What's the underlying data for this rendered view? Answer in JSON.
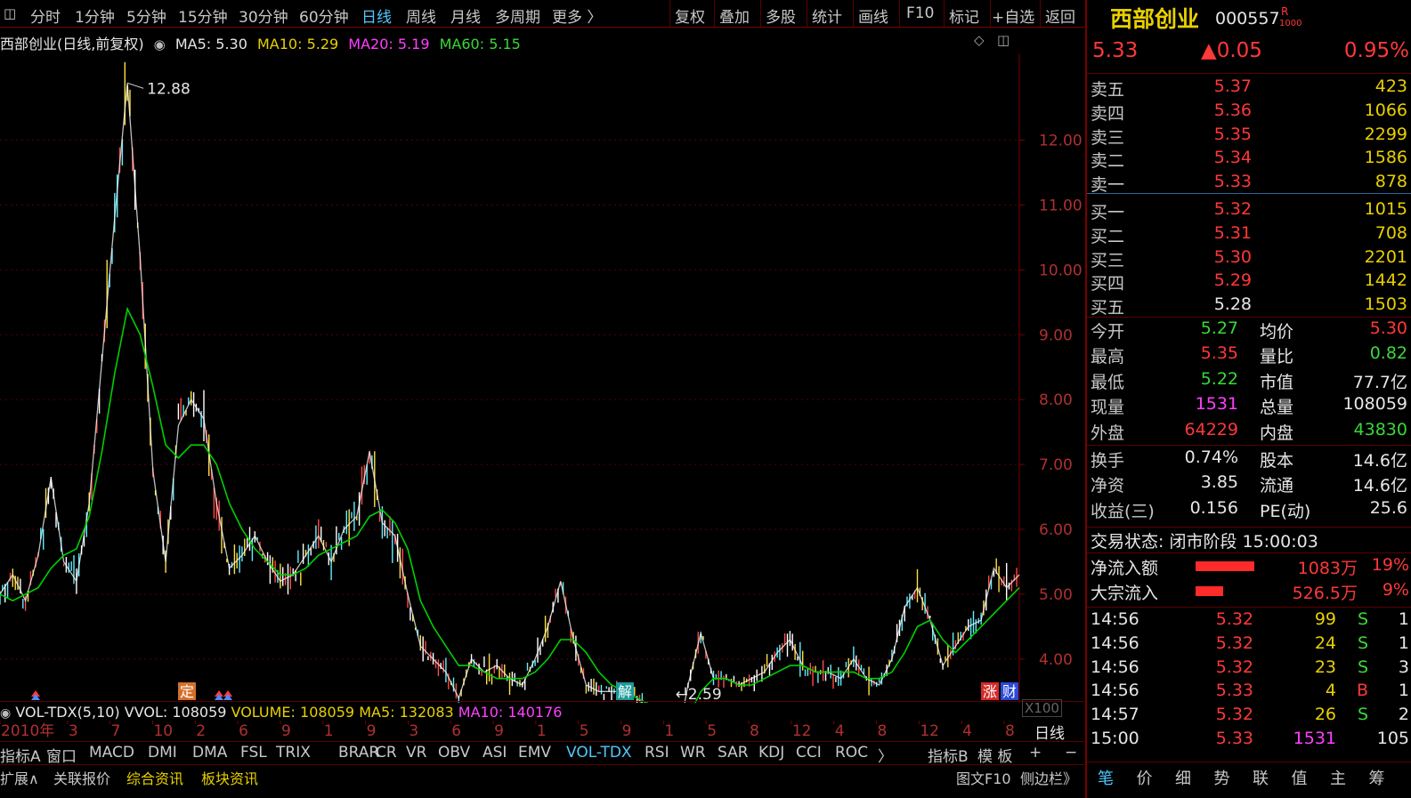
{
  "toolbar": {
    "tabs": [
      "分时",
      "1分钟",
      "5分钟",
      "15分钟",
      "30分钟",
      "60分钟",
      "日线",
      "周线",
      "月线",
      "多周期",
      "更多 〉"
    ],
    "active_tab": "日线",
    "right_buttons": [
      "复权",
      "叠加",
      "多股",
      "统计",
      "画线",
      "F10",
      "标记",
      "+自选",
      "返回"
    ]
  },
  "chart_header": {
    "title": "西部创业(日线,前复权)",
    "ma5": "MA5: 5.30",
    "ma10": "MA10: 5.29",
    "ma20": "MA20: 5.19",
    "ma60": "MA60: 5.15"
  },
  "chart_data": {
    "type": "line",
    "title": "西部创业(日线,前复权)",
    "y_axis_ticks": [
      "12.00",
      "11.00",
      "10.00",
      "9.00",
      "8.00",
      "7.00",
      "6.00",
      "5.00",
      "4.00"
    ],
    "ylim": [
      3.6,
      13.2
    ],
    "high_marker": "12.88",
    "low_marker": "2.59",
    "series": [
      {
        "name": "MA5",
        "color": "#ffffff"
      },
      {
        "name": "MA20",
        "color": "#00d000"
      }
    ],
    "price_path": [
      5.0,
      5.3,
      4.9,
      5.6,
      6.8,
      5.5,
      5.2,
      6.4,
      8.6,
      10.8,
      12.88,
      10.2,
      6.9,
      5.5,
      7.6,
      8.0,
      7.7,
      6.4,
      5.4,
      5.6,
      5.9,
      5.5,
      5.2,
      5.3,
      5.6,
      5.9,
      5.5,
      6.0,
      6.2,
      7.2,
      6.1,
      5.9,
      5.0,
      4.2,
      4.0,
      3.8,
      3.4,
      4.0,
      3.8,
      3.9,
      3.7,
      3.6,
      4.0,
      4.5,
      5.2,
      4.3,
      3.6,
      3.5,
      3.5,
      3.5,
      3.4,
      3.2,
      2.7,
      2.59,
      3.6,
      4.4,
      3.7,
      3.7,
      3.6,
      3.7,
      3.8,
      4.1,
      4.3,
      3.9,
      3.8,
      3.8,
      3.7,
      4.0,
      3.7,
      3.6,
      4.0,
      4.8,
      5.1,
      4.6,
      3.9,
      4.2,
      4.5,
      4.6,
      5.4,
      5.1,
      5.3
    ],
    "ma20_path": [
      5.0,
      4.9,
      5.0,
      5.1,
      5.4,
      5.6,
      5.7,
      6.2,
      7.2,
      8.4,
      9.4,
      9.0,
      8.2,
      7.3,
      7.1,
      7.3,
      7.3,
      7.0,
      6.4,
      6.0,
      5.7,
      5.5,
      5.3,
      5.3,
      5.4,
      5.6,
      5.7,
      5.8,
      5.9,
      6.2,
      6.3,
      6.1,
      5.7,
      4.9,
      4.5,
      4.2,
      3.9,
      3.9,
      3.8,
      3.7,
      3.7,
      3.7,
      3.8,
      4.0,
      4.3,
      4.3,
      4.1,
      3.8,
      3.6,
      3.5,
      3.4,
      3.3,
      3.1,
      2.9,
      3.1,
      3.5,
      3.7,
      3.7,
      3.6,
      3.6,
      3.7,
      3.8,
      3.9,
      3.9,
      3.8,
      3.8,
      3.8,
      3.8,
      3.7,
      3.7,
      3.8,
      4.1,
      4.5,
      4.6,
      4.3,
      4.1,
      4.3,
      4.5,
      4.7,
      4.9,
      5.1
    ],
    "x_labels": [
      "2010年",
      "3",
      "7",
      "10",
      "2",
      "6",
      "9",
      "1",
      "9",
      "3",
      "6",
      "9",
      "1",
      "5",
      "9",
      "1",
      "5",
      "8",
      "12",
      "4",
      "8",
      "12",
      "4",
      "8"
    ],
    "markers": [
      "定",
      "解",
      "涨",
      "财"
    ]
  },
  "indicator": {
    "name": "VOL-TDX(5,10)",
    "vvol": "VVOL: 108059",
    "volume": "VOLUME: 108059",
    "ma5": "MA5: 132083",
    "ma10": "MA10: 140176",
    "scale": "X100"
  },
  "bottom_tabs": [
    "指标A",
    "窗口",
    "MACD",
    "DMI",
    "DMA",
    "FSL",
    "TRIX",
    "BRAR",
    "CR",
    "VR",
    "OBV",
    "ASI",
    "EMV",
    "VOL-TDX",
    "RSI",
    "WR",
    "SAR",
    "KDJ",
    "CCI",
    "ROC",
    "〉"
  ],
  "bottom_tabs_right": [
    "指标B",
    "模 板"
  ],
  "active_indicator_tab": "VOL-TDX",
  "period_label": "日线",
  "bottom_bar": [
    "扩展∧",
    "关联报价",
    "综合资讯",
    "板块资讯"
  ],
  "bottom_bar_right": [
    "图文F10",
    "侧边栏》"
  ],
  "quote": {
    "name": "西部创业",
    "code": "000557",
    "r_mark": "R",
    "r_sub": "1000",
    "price": "5.33",
    "change": "▲0.05",
    "change_pct": "0.95%",
    "asks": [
      {
        "label": "卖五",
        "price": "5.37",
        "vol": "423"
      },
      {
        "label": "卖四",
        "price": "5.36",
        "vol": "1066"
      },
      {
        "label": "卖三",
        "price": "5.35",
        "vol": "2299"
      },
      {
        "label": "卖二",
        "price": "5.34",
        "vol": "1586"
      },
      {
        "label": "卖一",
        "price": "5.33",
        "vol": "878"
      }
    ],
    "bids": [
      {
        "label": "买一",
        "price": "5.32",
        "vol": "1015"
      },
      {
        "label": "买二",
        "price": "5.31",
        "vol": "708"
      },
      {
        "label": "买三",
        "price": "5.30",
        "vol": "2201"
      },
      {
        "label": "买四",
        "price": "5.29",
        "vol": "1442"
      },
      {
        "label": "买五",
        "price": "5.28",
        "vol": "1503"
      }
    ],
    "stats1": [
      {
        "l1": "今开",
        "v1": "5.27",
        "l2": "均价",
        "v2": "5.30"
      },
      {
        "l1": "最高",
        "v1": "5.35",
        "l2": "量比",
        "v2": "0.82"
      },
      {
        "l1": "最低",
        "v1": "5.22",
        "l2": "市值",
        "v2": "77.7亿"
      },
      {
        "l1": "现量",
        "v1": "1531",
        "l2": "总量",
        "v2": "108059"
      },
      {
        "l1": "外盘",
        "v1": "64229",
        "l2": "内盘",
        "v2": "43830"
      }
    ],
    "stats2": [
      {
        "l1": "换手",
        "v1": "0.74%",
        "l2": "股本",
        "v2": "14.6亿"
      },
      {
        "l1": "净资",
        "v1": "3.85",
        "l2": "流通",
        "v2": "14.6亿"
      },
      {
        "l1": "收益(三)",
        "v1": "0.156",
        "l2": "PE(动)",
        "v2": "25.6"
      }
    ],
    "trade_status": "交易状态: 闭市阶段 15:00:03",
    "net_inflow": {
      "label": "净流入额",
      "value": "1083万",
      "pct": "19%",
      "fraction": 0.19
    },
    "block_inflow": {
      "label": "大宗流入",
      "value": "526.5万",
      "pct": "9%",
      "fraction": 0.09
    },
    "ticks": [
      {
        "time": "14:56",
        "price": "5.32",
        "vol": "99",
        "side": "S",
        "n": "1"
      },
      {
        "time": "14:56",
        "price": "5.32",
        "vol": "24",
        "side": "S",
        "n": "1"
      },
      {
        "time": "14:56",
        "price": "5.32",
        "vol": "23",
        "side": "S",
        "n": "3"
      },
      {
        "time": "14:56",
        "price": "5.33",
        "vol": "4",
        "side": "B",
        "n": "1"
      },
      {
        "time": "14:57",
        "price": "5.32",
        "vol": "26",
        "side": "S",
        "n": "2"
      },
      {
        "time": "15:00",
        "price": "5.33",
        "vol": "1531",
        "side": "",
        "n": "105"
      }
    ],
    "footer_tabs": [
      "笔",
      "价",
      "细",
      "势",
      "联",
      "值",
      "主",
      "筹"
    ]
  }
}
